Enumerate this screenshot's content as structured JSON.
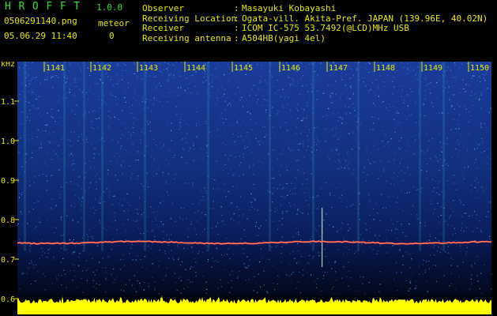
{
  "header": {
    "app_title": "H R O F F T",
    "app_version": "1.0.0",
    "filename": "0506291140.png",
    "timestamp": "05.06.29 11:40",
    "meteor_label": "meteor",
    "meteor_count": "0",
    "info": [
      {
        "key": "Observer",
        "value": "Masayuki Kobayashi"
      },
      {
        "key": "Receiving Location",
        "value": "Ogata-vill. Akita-Pref. JAPAN (139.96E, 40.02N)"
      },
      {
        "key": "Receiver",
        "value": "ICOM IC-575 53.7492(@LCD)MHz USB"
      },
      {
        "key": "Receiving antenna",
        "value": "A504HB(yagi 4el)"
      }
    ]
  },
  "spectrogram": {
    "y_unit": "kHz",
    "y_ticks": [
      "1.1",
      "1.0",
      "0.9",
      "0.8",
      "0.7",
      "0.6"
    ],
    "x_ticks": [
      "1141",
      "1142",
      "1143",
      "1144",
      "1145",
      "1146",
      "1147",
      "1148",
      "1149",
      "1150"
    ],
    "colors": {
      "text": "#e8e800",
      "background": "#000000",
      "noise_floor": "#0a1a5a",
      "signal_line": "#ff4060",
      "level_bar": "#ffff00"
    }
  }
}
